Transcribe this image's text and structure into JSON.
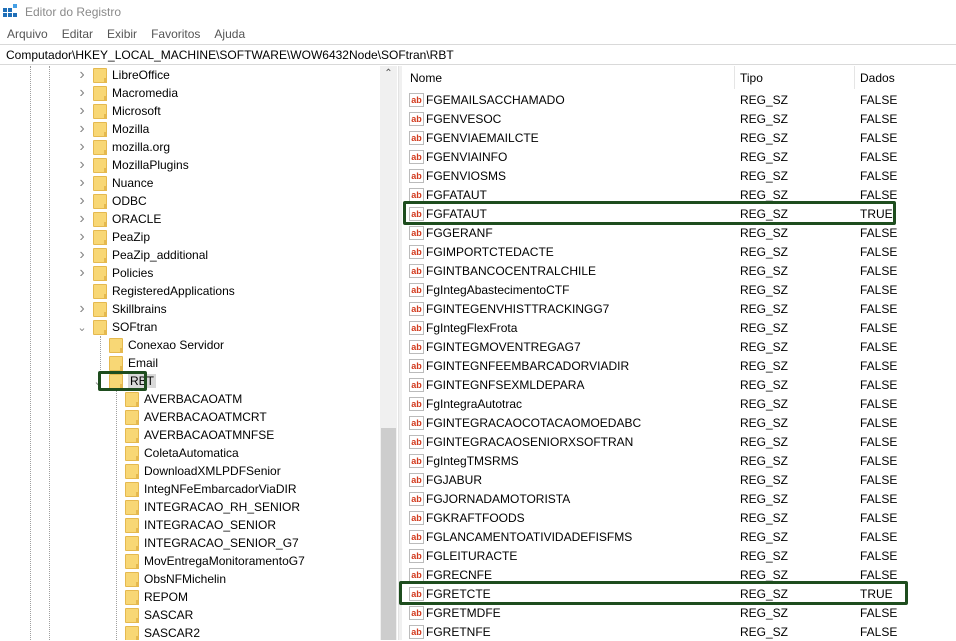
{
  "window": {
    "title": "Editor do Registro"
  },
  "menu": [
    "Arquivo",
    "Editar",
    "Exibir",
    "Favoritos",
    "Ajuda"
  ],
  "address": "Computador\\HKEY_LOCAL_MACHINE\\SOFTWARE\\WOW6432Node\\SOFtran\\RBT",
  "tree": [
    {
      "label": "LibreOffice",
      "level": 0,
      "state": "collapsed"
    },
    {
      "label": "Macromedia",
      "level": 0,
      "state": "collapsed"
    },
    {
      "label": "Microsoft",
      "level": 0,
      "state": "collapsed"
    },
    {
      "label": "Mozilla",
      "level": 0,
      "state": "collapsed"
    },
    {
      "label": "mozilla.org",
      "level": 0,
      "state": "collapsed"
    },
    {
      "label": "MozillaPlugins",
      "level": 0,
      "state": "collapsed"
    },
    {
      "label": "Nuance",
      "level": 0,
      "state": "collapsed"
    },
    {
      "label": "ODBC",
      "level": 0,
      "state": "collapsed"
    },
    {
      "label": "ORACLE",
      "level": 0,
      "state": "collapsed"
    },
    {
      "label": "PeaZip",
      "level": 0,
      "state": "collapsed"
    },
    {
      "label": "PeaZip_additional",
      "level": 0,
      "state": "collapsed"
    },
    {
      "label": "Policies",
      "level": 0,
      "state": "collapsed"
    },
    {
      "label": "RegisteredApplications",
      "level": 0,
      "state": "none"
    },
    {
      "label": "Skillbrains",
      "level": 0,
      "state": "collapsed"
    },
    {
      "label": "SOFtran",
      "level": 0,
      "state": "expanded"
    },
    {
      "label": "Conexao Servidor",
      "level": 1,
      "state": "none"
    },
    {
      "label": "Email",
      "level": 1,
      "state": "none"
    },
    {
      "label": "RBT",
      "level": 1,
      "state": "expanded",
      "selected": true
    },
    {
      "label": "AVERBACAOATM",
      "level": 2,
      "state": "none"
    },
    {
      "label": "AVERBACAOATMCRT",
      "level": 2,
      "state": "none"
    },
    {
      "label": "AVERBACAOATMNFSE",
      "level": 2,
      "state": "none"
    },
    {
      "label": "ColetaAutomatica",
      "level": 2,
      "state": "none"
    },
    {
      "label": "DownloadXMLPDFSenior",
      "level": 2,
      "state": "none"
    },
    {
      "label": "IntegNFeEmbarcadorViaDIR",
      "level": 2,
      "state": "none"
    },
    {
      "label": "INTEGRACAO_RH_SENIOR",
      "level": 2,
      "state": "none"
    },
    {
      "label": "INTEGRACAO_SENIOR",
      "level": 2,
      "state": "none"
    },
    {
      "label": "INTEGRACAO_SENIOR_G7",
      "level": 2,
      "state": "none"
    },
    {
      "label": "MovEntregaMonitoramentoG7",
      "level": 2,
      "state": "none"
    },
    {
      "label": "ObsNFMichelin",
      "level": 2,
      "state": "none"
    },
    {
      "label": "REPOM",
      "level": 2,
      "state": "none"
    },
    {
      "label": "SASCAR",
      "level": 2,
      "state": "none"
    },
    {
      "label": "SASCAR2",
      "level": 2,
      "state": "none"
    }
  ],
  "columns": {
    "name": "Nome",
    "type": "Tipo",
    "data": "Dados"
  },
  "values": [
    {
      "name": "FGEMAILSACCHAMADO",
      "type": "REG_SZ",
      "data": "FALSE"
    },
    {
      "name": "FGENVESOC",
      "type": "REG_SZ",
      "data": "FALSE"
    },
    {
      "name": "FGENVIAEMAILCTE",
      "type": "REG_SZ",
      "data": "FALSE"
    },
    {
      "name": "FGENVIAINFO",
      "type": "REG_SZ",
      "data": "FALSE"
    },
    {
      "name": "FGENVIOSMS",
      "type": "REG_SZ",
      "data": "FALSE"
    },
    {
      "name": "FGFATAUT",
      "type": "REG_SZ",
      "data": "FALSE"
    },
    {
      "name": "FGFATAUT",
      "type": "REG_SZ",
      "data": "TRUE",
      "highlighted": true
    },
    {
      "name": "FGGERANF",
      "type": "REG_SZ",
      "data": "FALSE"
    },
    {
      "name": "FGIMPORTCTEDACTE",
      "type": "REG_SZ",
      "data": "FALSE"
    },
    {
      "name": "FGINTBANCOCENTRALCHILE",
      "type": "REG_SZ",
      "data": "FALSE"
    },
    {
      "name": "FgIntegAbastecimentoCTF",
      "type": "REG_SZ",
      "data": "FALSE"
    },
    {
      "name": "FGINTEGENVHISTTRACKINGG7",
      "type": "REG_SZ",
      "data": "FALSE"
    },
    {
      "name": "FgIntegFlexFrota",
      "type": "REG_SZ",
      "data": "FALSE"
    },
    {
      "name": "FGINTEGMOVENTREGAG7",
      "type": "REG_SZ",
      "data": "FALSE"
    },
    {
      "name": "FGINTEGNFEEMBARCADORVIADIR",
      "type": "REG_SZ",
      "data": "FALSE"
    },
    {
      "name": "FGINTEGNFSEXMLDEPARA",
      "type": "REG_SZ",
      "data": "FALSE"
    },
    {
      "name": "FgIntegraAutotrac",
      "type": "REG_SZ",
      "data": "FALSE"
    },
    {
      "name": "FGINTEGRACAOCOTACAOMOEDABC",
      "type": "REG_SZ",
      "data": "FALSE"
    },
    {
      "name": "FGINTEGRACAOSENIORXSOFTRAN",
      "type": "REG_SZ",
      "data": "FALSE"
    },
    {
      "name": "FgIntegTMSRMS",
      "type": "REG_SZ",
      "data": "FALSE"
    },
    {
      "name": "FGJABUR",
      "type": "REG_SZ",
      "data": "FALSE"
    },
    {
      "name": "FGJORNADAMOTORISTA",
      "type": "REG_SZ",
      "data": "FALSE"
    },
    {
      "name": "FGKRAFTFOODS",
      "type": "REG_SZ",
      "data": "FALSE"
    },
    {
      "name": "FGLANCAMENTOATIVIDADEFISFMS",
      "type": "REG_SZ",
      "data": "FALSE"
    },
    {
      "name": "FGLEITURACTE",
      "type": "REG_SZ",
      "data": "FALSE"
    },
    {
      "name": "FGRECNFE",
      "type": "REG_SZ",
      "data": "FALSE"
    },
    {
      "name": "FGRETCTE",
      "type": "REG_SZ",
      "data": "TRUE",
      "highlighted": true
    },
    {
      "name": "FGRETMDFE",
      "type": "REG_SZ",
      "data": "FALSE"
    },
    {
      "name": "FGRETNFE",
      "type": "REG_SZ",
      "data": "FALSE"
    }
  ],
  "icons": {
    "value": "ab-string-icon"
  },
  "colors": {
    "highlight": "#1e4d1e",
    "ab": "#d2391c",
    "folder": "#f8d775"
  }
}
